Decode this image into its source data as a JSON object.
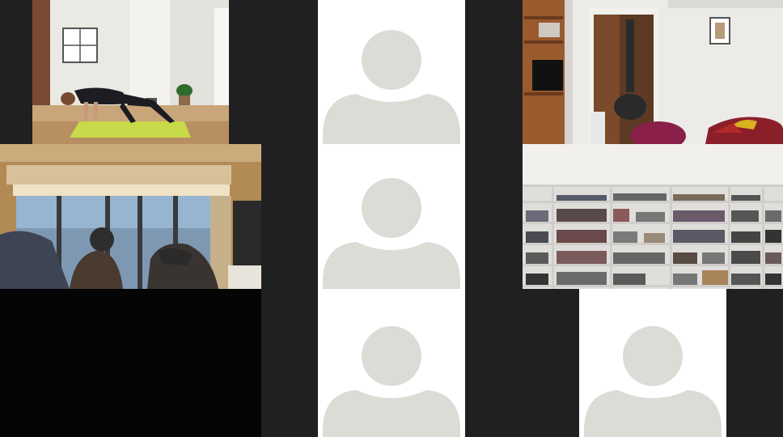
{
  "meeting": {
    "view": "gallery",
    "participant_tiles": [
      {
        "id": "yoga-studio-feed",
        "kind": "video"
      },
      {
        "id": "placeholder-top-center",
        "kind": "avatar"
      },
      {
        "id": "hallway-feed",
        "kind": "video"
      },
      {
        "id": "living-room-feed",
        "kind": "video"
      },
      {
        "id": "placeholder-middle-center",
        "kind": "avatar"
      },
      {
        "id": "bookshelf-feed",
        "kind": "video"
      },
      {
        "id": "placeholder-bottom-center",
        "kind": "avatar"
      },
      {
        "id": "placeholder-bottom-right",
        "kind": "avatar"
      }
    ]
  },
  "colors": {
    "background": "#1a1a1a",
    "avatar_tile": "#ffffff",
    "avatar_silhouette": "#dddbd6",
    "yoga_mat": "#c8d94a"
  }
}
